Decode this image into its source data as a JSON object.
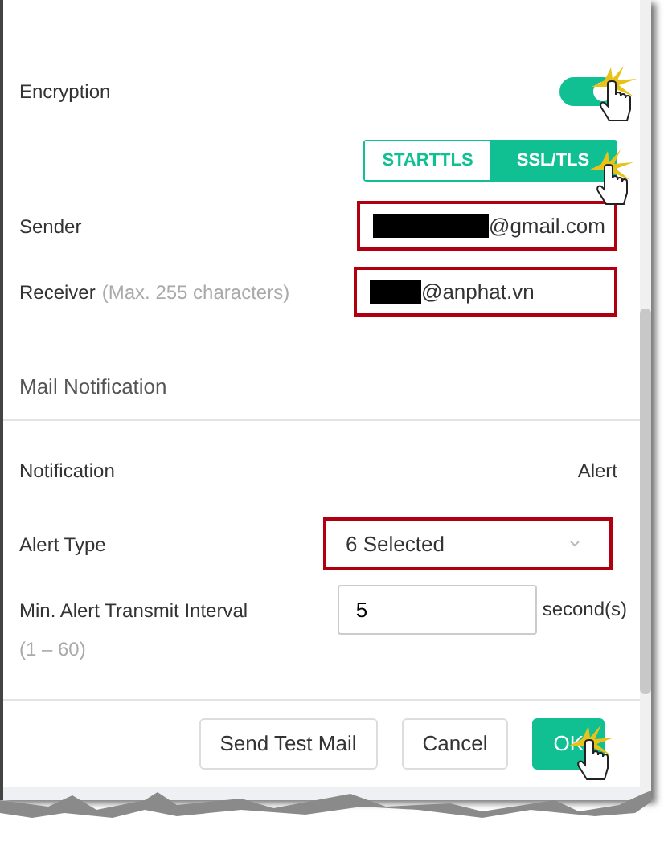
{
  "encryption": {
    "label": "Encryption",
    "on": true
  },
  "protocols": [
    {
      "label": "STARTTLS",
      "selected": false
    },
    {
      "label": "SSL/TLS",
      "selected": true
    }
  ],
  "sender": {
    "label": "Sender",
    "value": "@gmail.com",
    "highlighted": true
  },
  "receiver": {
    "label": "Receiver",
    "hint": "(Max. 255 characters)",
    "value": "@anphat.vn",
    "highlighted": true
  },
  "section_title": "Mail Notification",
  "notification": {
    "label": "Notification",
    "value": "Alert"
  },
  "alert_type": {
    "label": "Alert Type",
    "value": "6 Selected",
    "highlighted": true
  },
  "interval": {
    "label": "Min. Alert Transmit Interval",
    "range": "(1 – 60)",
    "value": "5",
    "unit": "second(s)"
  },
  "buttons": [
    {
      "label": "Send Test Mail",
      "kind": "default"
    },
    {
      "label": "Cancel",
      "kind": "default"
    },
    {
      "label": "OK",
      "kind": "primary"
    }
  ]
}
